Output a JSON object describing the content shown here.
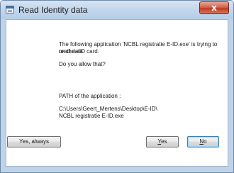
{
  "window": {
    "title": "Read Identity data",
    "close_glyph": "x"
  },
  "message": {
    "line1": "The following application 'NCBL registratie E-ID.exe' is trying to read data",
    "line2": "on the eID card.",
    "question": "Do you allow that?",
    "path_label": "PATH of the application :",
    "path_line1": "C:\\Users\\Geert_Mertens\\Desktop\\E-ID\\",
    "path_line2": "NCBL registratie E-ID.exe"
  },
  "buttons": {
    "yes_always": "Yes, always",
    "yes_mnemonic": "Y",
    "yes_rest": "es",
    "no_mnemonic": "N",
    "no_rest": "o"
  },
  "icons": {
    "app": "window-app-icon",
    "close": "close-icon"
  }
}
